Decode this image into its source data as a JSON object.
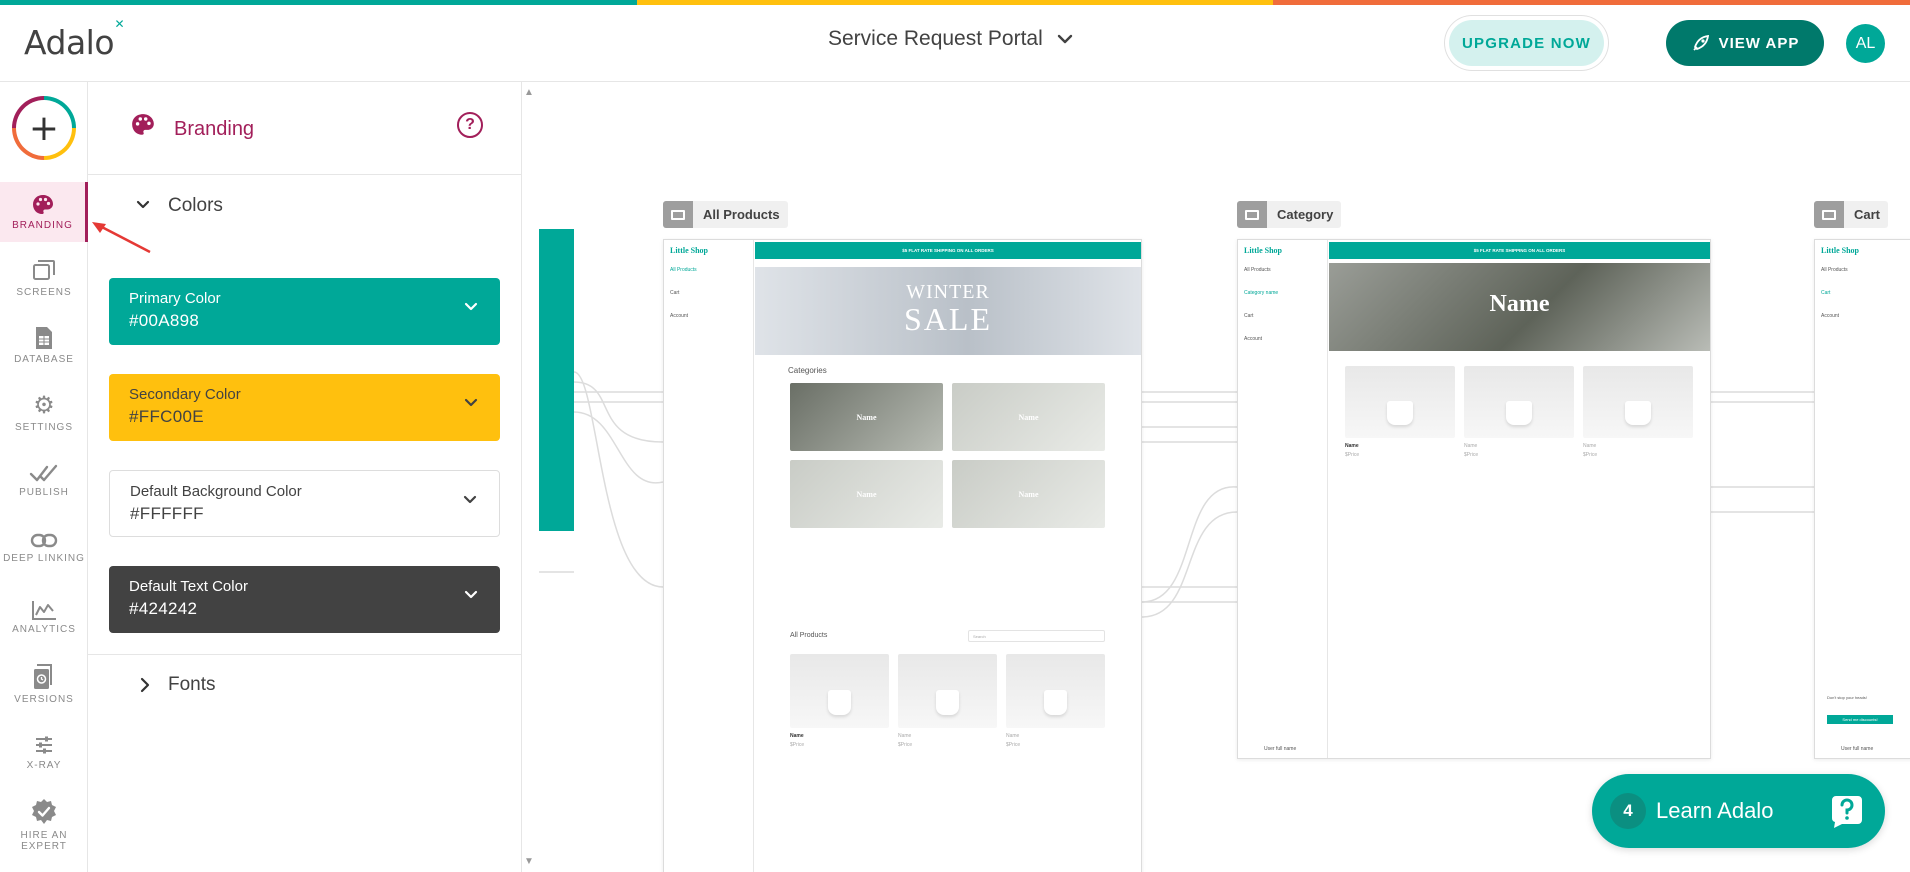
{
  "colors": {
    "teal": "#00A898",
    "yellow": "#FFC00E",
    "coral": "#F06C3B",
    "magenta": "#A21F5A",
    "dark": "#424242",
    "dark_teal": "#00796B"
  },
  "header": {
    "logo": "Adalo",
    "project_name": "Service Request Portal",
    "upgrade_label": "UPGRADE NOW",
    "view_app_label": "VIEW APP",
    "avatar_initials": "AL"
  },
  "rail": {
    "items": [
      {
        "label": "BRANDING",
        "icon": "palette-icon"
      },
      {
        "label": "SCREENS",
        "icon": "screens-icon"
      },
      {
        "label": "DATABASE",
        "icon": "database-icon"
      },
      {
        "label": "SETTINGS",
        "icon": "gear-icon"
      },
      {
        "label": "PUBLISH",
        "icon": "publish-check-icon"
      },
      {
        "label": "DEEP LINKING",
        "icon": "link-icon"
      },
      {
        "label": "ANALYTICS",
        "icon": "analytics-icon"
      },
      {
        "label": "VERSIONS",
        "icon": "versions-icon"
      },
      {
        "label": "X-RAY",
        "icon": "sliders-icon"
      },
      {
        "label": "HIRE AN EXPERT",
        "icon": "expert-badge-icon"
      }
    ]
  },
  "panel": {
    "title": "Branding",
    "colors_section": "Colors",
    "fonts_section": "Fonts",
    "color_settings": [
      {
        "label": "Primary Color",
        "value": "#00A898"
      },
      {
        "label": "Secondary Color",
        "value": "#FFC00E"
      },
      {
        "label": "Default Background Color",
        "value": "#FFFFFF"
      },
      {
        "label": "Default Text Color",
        "value": "#424242"
      }
    ]
  },
  "canvas": {
    "screens": [
      {
        "name": "All Products"
      },
      {
        "name": "Category"
      },
      {
        "name": "Cart"
      }
    ],
    "mini": {
      "brand": "Little Shop",
      "nav_all_products": "All Products",
      "nav_cart": "Cart",
      "nav_account": "Account",
      "nav_category": "Category name",
      "banner": "$5 FLAT RATE SHIPPING ON ALL ORDERS",
      "hero_line1": "WINTER",
      "hero_line2": "SALE",
      "categories_heading": "Categories",
      "tile_name": "Name",
      "all_products_heading": "All Products",
      "search_placeholder": "Search",
      "product_name": "Name",
      "product_price": "$Price",
      "category_hero": "Name",
      "user_full_name": "User full name",
      "cart_promo_title": "Don't stop your heads!",
      "cart_promo_button": "Send me discounts!"
    }
  },
  "learn": {
    "count": "4",
    "label": "Learn Adalo"
  }
}
